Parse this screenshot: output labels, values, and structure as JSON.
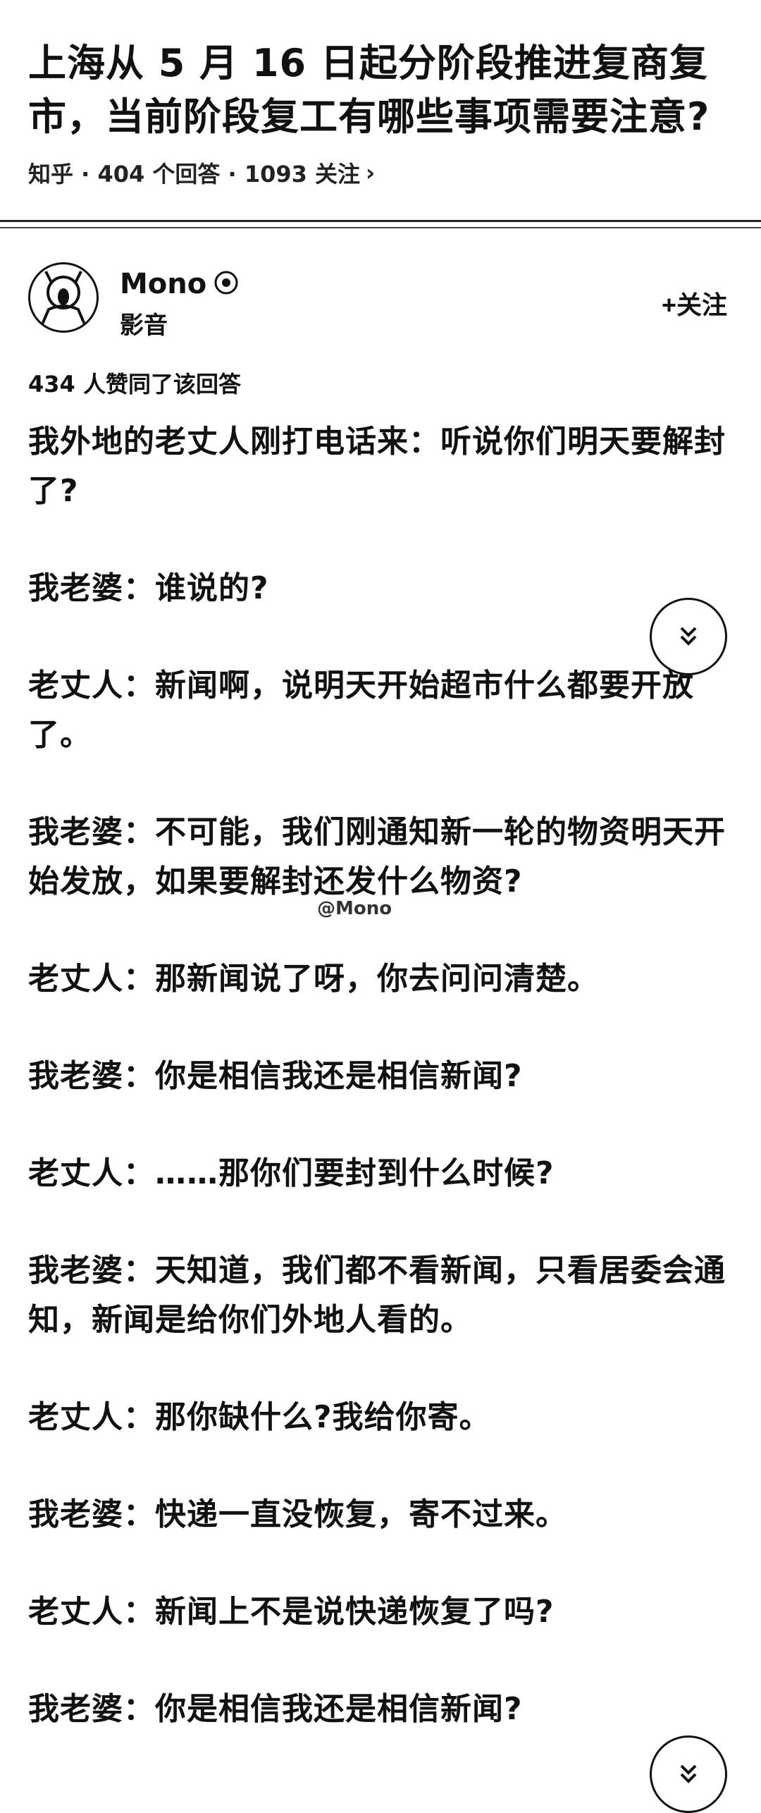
{
  "question": {
    "title": "上海从 5 月 16 日起分阶段推进复商复市，当前阶段复工有哪些事项需要注意?",
    "meta": "知乎 · 404 个回答 · 1093 关注",
    "meta_arrow": "›"
  },
  "author": {
    "name": "Mono",
    "description": "影音",
    "follow_label": "+关注"
  },
  "likes": "434 人赞同了该回答",
  "watermark": "@Mono",
  "content": [
    "我外地的老丈人刚打电话来：听说你们明天要解封了?",
    "我老婆：谁说的?",
    "老丈人：新闻啊，说明天开始超市什么都要开放了。",
    "我老婆：不可能，我们刚通知新一轮的物资明天开始发放，如果要解封还发什么物资?",
    "老丈人：那新闻说了呀，你去问问清楚。",
    "我老婆：你是相信我还是相信新闻?",
    "老丈人：……那你们要封到什么时候?",
    "我老婆：天知道，我们都不看新闻，只看居委会通知，新闻是给你们外地人看的。",
    "老丈人：那你缺什么?我给你寄。",
    "我老婆：快递一直没恢复，寄不过来。",
    "老丈人：新闻上不是说快递恢复了吗?",
    "我老婆：你是相信我还是相信新闻?"
  ],
  "icons": {
    "avatar": "avatar-icon",
    "badge": "verified-badge-icon",
    "scroll": "double-chevron-down-icon"
  }
}
